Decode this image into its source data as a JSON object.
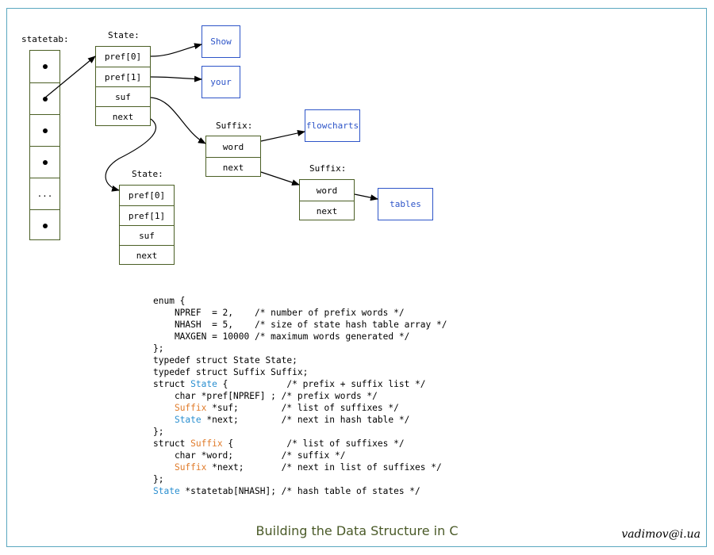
{
  "labels": {
    "statetab": "statetab:",
    "state1": "State:",
    "state2": "State:",
    "suffix1": "Suffix:",
    "suffix2": "Suffix:"
  },
  "statetab": {
    "ellipsis": "..."
  },
  "state1": {
    "cells": [
      "pref[0]",
      "pref[1]",
      "suf",
      "next"
    ]
  },
  "state2": {
    "cells": [
      "pref[0]",
      "pref[1]",
      "suf",
      "next"
    ]
  },
  "suffix1": {
    "cells": [
      "word",
      "next"
    ]
  },
  "suffix2": {
    "cells": [
      "word",
      "next"
    ]
  },
  "words": {
    "show": "Show",
    "your": "your",
    "flowcharts": "flowcharts",
    "tables": "tables"
  },
  "code": [
    [
      [
        "enum {",
        ""
      ]
    ],
    [
      [
        "    NPREF  = 2,    /* number of prefix words */",
        ""
      ]
    ],
    [
      [
        "    NHASH  = 5,    /* size of state hash table array */",
        ""
      ]
    ],
    [
      [
        "    MAXGEN = 10000 /* maximum words generated */",
        ""
      ]
    ],
    [
      [
        "};",
        ""
      ]
    ],
    [
      [
        "typedef struct State State;",
        ""
      ]
    ],
    [
      [
        "typedef struct Suffix Suffix;",
        ""
      ]
    ],
    [
      [
        "struct ",
        ""
      ],
      [
        "State",
        "blue"
      ],
      [
        " {           /* prefix + suffix list */",
        ""
      ]
    ],
    [
      [
        "    char *pref[NPREF] ; /* prefix words */",
        ""
      ]
    ],
    [
      [
        "    ",
        ""
      ],
      [
        "Suffix",
        "orange"
      ],
      [
        " *suf;        /* list of suffixes */",
        ""
      ]
    ],
    [
      [
        "    ",
        ""
      ],
      [
        "State",
        "blue"
      ],
      [
        " *next;        /* next in hash table */",
        ""
      ]
    ],
    [
      [
        "};",
        ""
      ]
    ],
    [
      [
        "struct ",
        ""
      ],
      [
        "Suffix",
        "orange"
      ],
      [
        " {          /* list of suffixes */",
        ""
      ]
    ],
    [
      [
        "    char *word;         /* suffix */",
        ""
      ]
    ],
    [
      [
        "    ",
        ""
      ],
      [
        "Suffix",
        "orange"
      ],
      [
        " *next;       /* next in list of suffixes */",
        ""
      ]
    ],
    [
      [
        "};",
        ""
      ]
    ],
    [
      [
        "State",
        "blue"
      ],
      [
        " *statetab[NHASH]; /* hash table of states */",
        ""
      ]
    ]
  ],
  "caption": "Building the Data Structure in C",
  "credit": "vadimov@i.ua"
}
